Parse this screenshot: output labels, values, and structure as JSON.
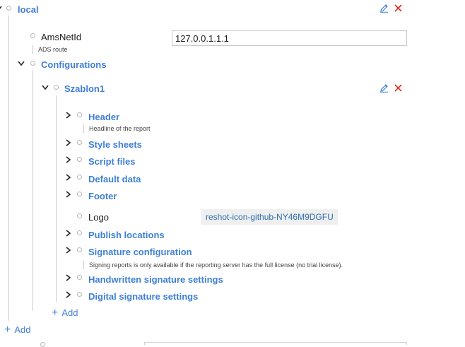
{
  "root": {
    "label": "local",
    "add_label": "Add"
  },
  "ams_net_id": {
    "label": "AmsNetId",
    "description": "ADS route",
    "value": "127.0.0.1.1.1"
  },
  "configurations": {
    "label": "Configurations",
    "add_label": "Add",
    "szablon": {
      "label": "Szablon1",
      "children": {
        "header": {
          "label": "Header",
          "description": "Headline of the report"
        },
        "style_sheets": {
          "label": "Style sheets"
        },
        "script_files": {
          "label": "Script files"
        },
        "default_data": {
          "label": "Default data"
        },
        "footer": {
          "label": "Footer"
        },
        "logo": {
          "label": "Logo",
          "value": "reshot-icon-github-NY46M9DGFU"
        },
        "publish_locations": {
          "label": "Publish locations"
        },
        "signature_configuration": {
          "label": "Signature configuration",
          "description": "Signing reports is only available if the reporting server has the full license (no trial license)."
        },
        "handwritten_signature_settings": {
          "label": "Handwritten signature settings"
        },
        "digital_signature_settings": {
          "label": "Digital signature settings"
        }
      }
    }
  },
  "colors": {
    "link": "#3f7fd6",
    "delete": "#d93025",
    "tree_line": "#c8c8c8"
  },
  "icons": {
    "edit": "pencil-icon",
    "delete": "close-icon",
    "expand": "chevron-right-icon",
    "collapse": "chevron-down-icon",
    "node": "circle-icon",
    "add": "plus-icon"
  }
}
